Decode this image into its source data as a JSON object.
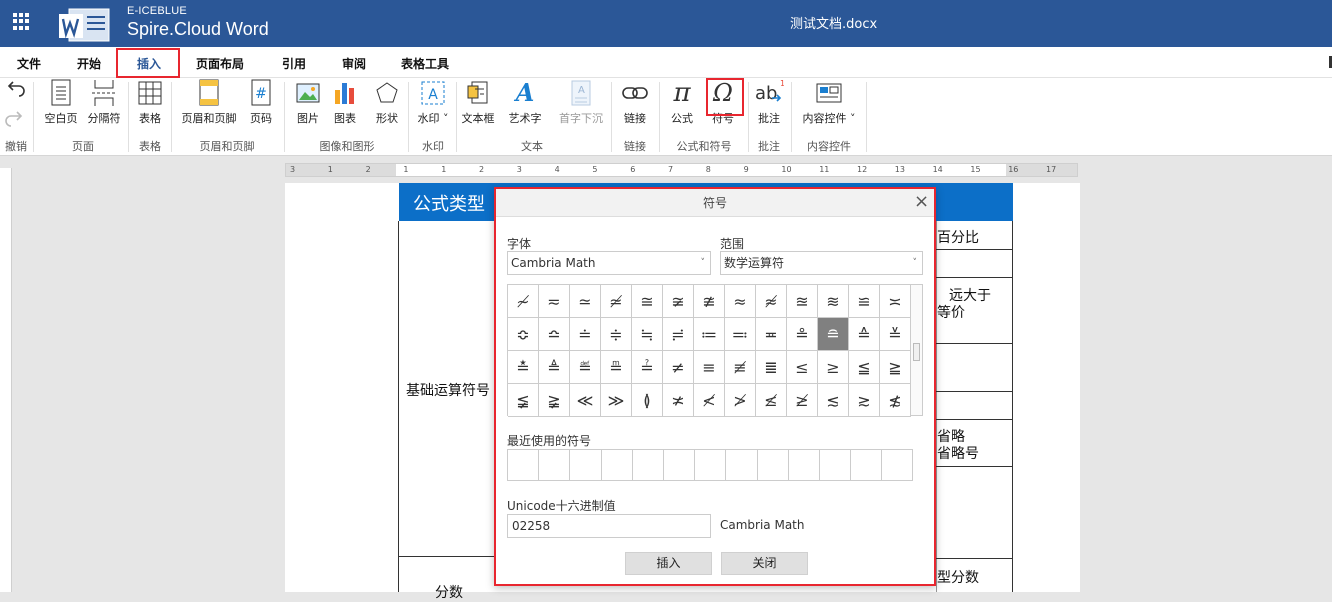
{
  "app": {
    "brand_small": "E-ICEBLUE",
    "brand_name": "Spire.Cloud Word",
    "document_title": "测试文档.docx"
  },
  "menu": [
    "文件",
    "开始",
    "插入",
    "页面布局",
    "引用",
    "审阅",
    "表格工具"
  ],
  "ribbon": {
    "undo_group": "撤销",
    "buttons": {
      "blank_page": "空白页",
      "page_break": "分隔符",
      "table": "表格",
      "header_footer": "页眉和页脚",
      "page_number": "页码",
      "picture": "图片",
      "chart": "图表",
      "shape": "形状",
      "watermark": "水印",
      "textbox": "文本框",
      "wordart": "艺术字",
      "dropcap": "首字下沉",
      "link": "链接",
      "formula": "公式",
      "symbol": "符号",
      "comment": "批注",
      "content_control": "内容控件"
    },
    "groups": {
      "page": "页面",
      "table": "表格",
      "header_footer": "页眉和页脚",
      "image_shape": "图像和图形",
      "watermark": "水印",
      "text": "文本",
      "link": "链接",
      "formula_symbol": "公式和符号",
      "comment": "批注",
      "content_control": "内容控件"
    }
  },
  "document": {
    "header_text": "公式类型",
    "row_label_basic": "基础运算符号",
    "row_label_fraction": "分数",
    "right_cells": [
      "百分比",
      "远大于",
      "等价",
      "省略",
      "省略号",
      "型分数"
    ]
  },
  "dialog": {
    "title": "符号",
    "font_label": "字体",
    "font_value": "Cambria Math",
    "range_label": "范围",
    "range_value": "数学运算符",
    "symbols": [
      "≁",
      "≂",
      "≃",
      "≄",
      "≅",
      "≆",
      "≇",
      "≈",
      "≉",
      "≊",
      "≋",
      "≌",
      "≍",
      "≎",
      "≏",
      "≐",
      "≑",
      "≒",
      "≓",
      "≔",
      "≕",
      "≖",
      "≗",
      "≘",
      "≙",
      "≚",
      "≛",
      "≜",
      "≝",
      "≞",
      "≟",
      "≠",
      "≡",
      "≢",
      "≣",
      "≤",
      "≥",
      "≦",
      "≧",
      "≨",
      "≩",
      "≪",
      "≫",
      "≬",
      "≭",
      "≮",
      "≯",
      "≰",
      "≱",
      "≲",
      "≳",
      "≴"
    ],
    "selected_symbol": "≘",
    "recent_label": "最近使用的符号",
    "unicode_label": "Unicode十六进制值",
    "unicode_value": "02258",
    "font_readout": "Cambria Math",
    "insert_button": "插入",
    "close_button": "关闭"
  },
  "ruler_numbers": [
    "3",
    "1",
    "2",
    "1",
    "1",
    "2",
    "3",
    "4",
    "5",
    "6",
    "7",
    "8",
    "9",
    "10",
    "11",
    "12",
    "13",
    "14",
    "15",
    "16",
    "17"
  ],
  "colors": {
    "topbar": "#2b5797",
    "table_header": "#0c6fc8",
    "highlight": "#e8262f",
    "selected_symbol_bg": "#808080"
  }
}
